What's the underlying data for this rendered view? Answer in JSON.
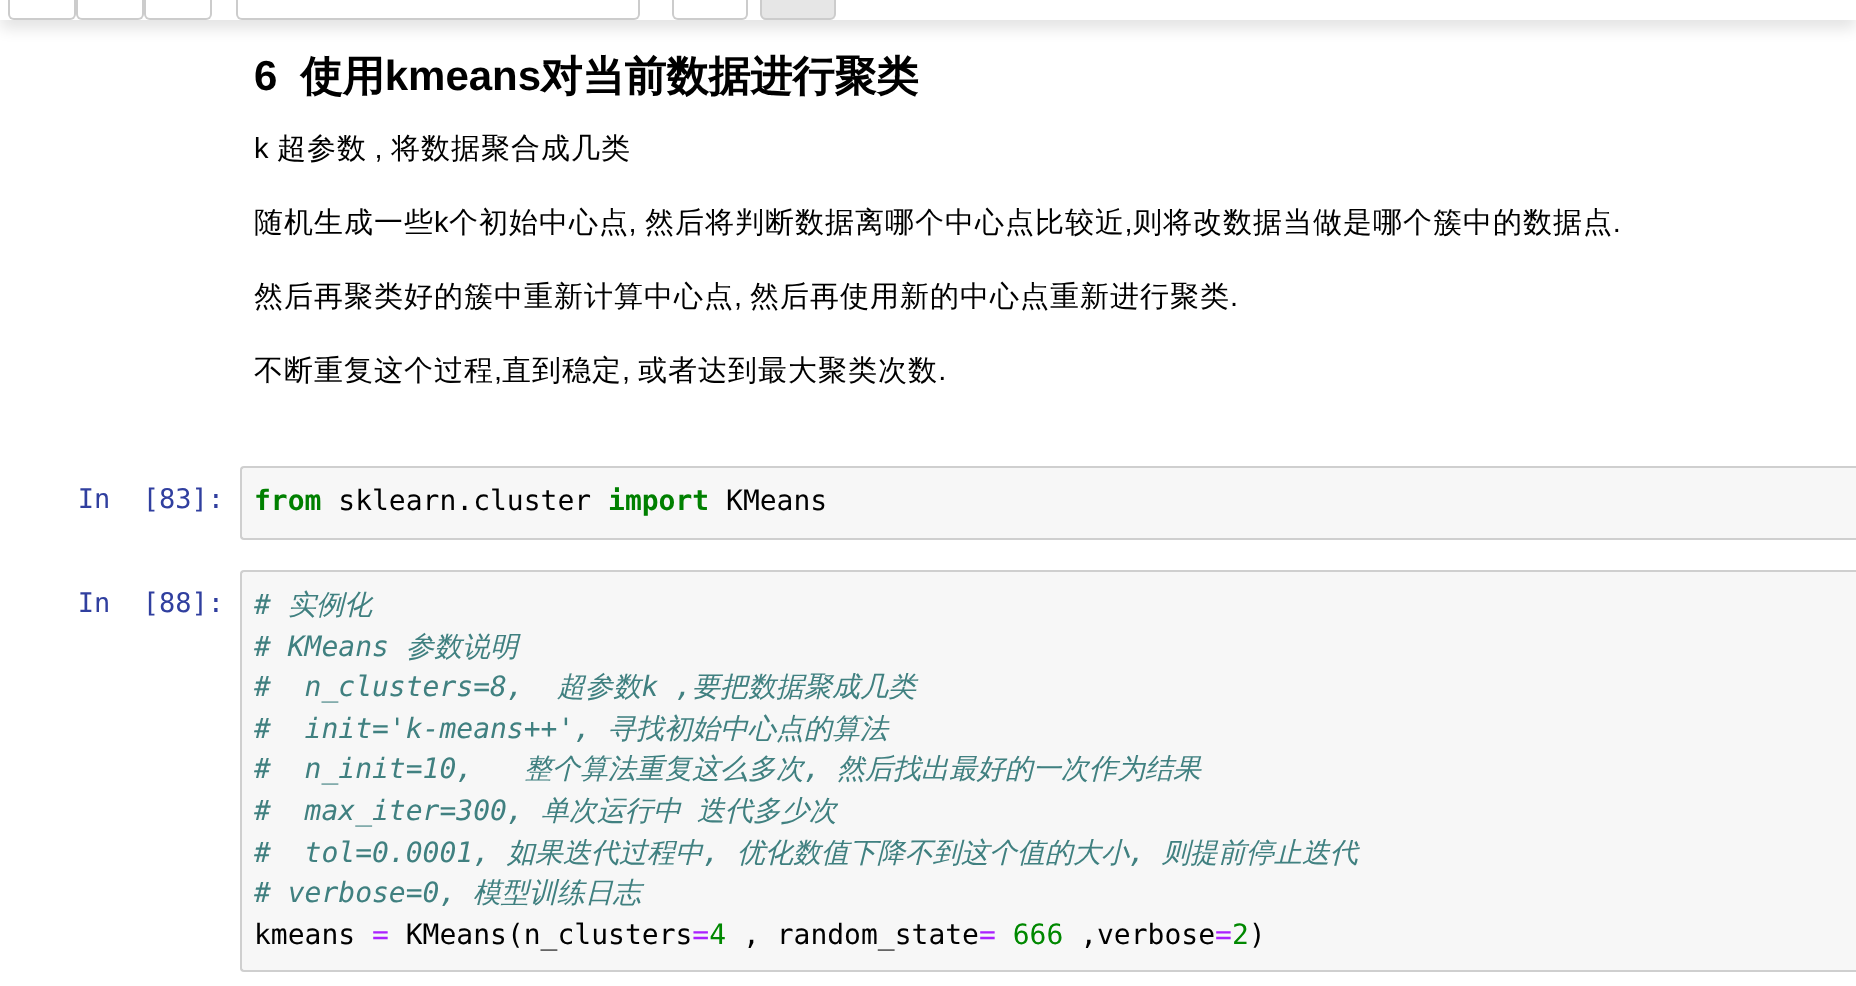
{
  "toolbar": {
    "buttons": [
      {
        "kind": "group"
      },
      {
        "kind": "group"
      },
      {
        "kind": "group"
      },
      {
        "kind": "select"
      },
      {
        "kind": "single"
      },
      {
        "kind": "pressed"
      }
    ]
  },
  "markdown": {
    "heading": "6  使用kmeans对当前数据进行聚类",
    "paragraphs": [
      "k 超参数 , 将数据聚合成几类",
      "随机生成一些k个初始中心点, 然后将判断数据离哪个中心点比较近,则将改数据当做是哪个簇中的数据点.",
      "然后再聚类好的簇中重新计算中心点, 然后再使用新的中心点重新进行聚类.",
      "不断重复这个过程,直到稳定, 或者达到最大聚类次数."
    ]
  },
  "cells": [
    {
      "prompt": "In  [83]:",
      "lines": [
        [
          {
            "kind": "keyword",
            "text": "from"
          },
          {
            "kind": "text",
            "text": " sklearn.cluster "
          },
          {
            "kind": "keyword",
            "text": "import"
          },
          {
            "kind": "text",
            "text": " KMeans"
          }
        ]
      ]
    },
    {
      "prompt": "In  [88]:",
      "lines": [
        [
          {
            "kind": "comment",
            "text": "# 实例化"
          }
        ],
        [
          {
            "kind": "comment",
            "text": "# KMeans 参数说明"
          }
        ],
        [
          {
            "kind": "comment",
            "text": "#  n_clusters=8,  超参数k ,要把数据聚成几类"
          }
        ],
        [
          {
            "kind": "comment",
            "text": "#  init='k-means++', 寻找初始中心点的算法"
          }
        ],
        [
          {
            "kind": "comment",
            "text": "#  n_init=10,   整个算法重复这么多次, 然后找出最好的一次作为结果"
          }
        ],
        [
          {
            "kind": "comment",
            "text": "#  max_iter=300, 单次运行中 迭代多少次"
          }
        ],
        [
          {
            "kind": "comment",
            "text": "#  tol=0.0001, 如果迭代过程中, 优化数值下降不到这个值的大小, 则提前停止迭代"
          }
        ],
        [
          {
            "kind": "comment",
            "text": "# verbose=0, 模型训练日志"
          }
        ],
        [
          {
            "kind": "text",
            "text": "kmeans "
          },
          {
            "kind": "operator",
            "text": "="
          },
          {
            "kind": "text",
            "text": " KMeans(n_clusters"
          },
          {
            "kind": "operator",
            "text": "="
          },
          {
            "kind": "number",
            "text": "4"
          },
          {
            "kind": "text",
            "text": " , random_state"
          },
          {
            "kind": "operator",
            "text": "="
          },
          {
            "kind": "number",
            "text": " 666"
          },
          {
            "kind": "text",
            "text": " ,verbose"
          },
          {
            "kind": "operator",
            "text": "="
          },
          {
            "kind": "number",
            "text": "2"
          },
          {
            "kind": "text",
            "text": ")"
          }
        ]
      ]
    }
  ]
}
